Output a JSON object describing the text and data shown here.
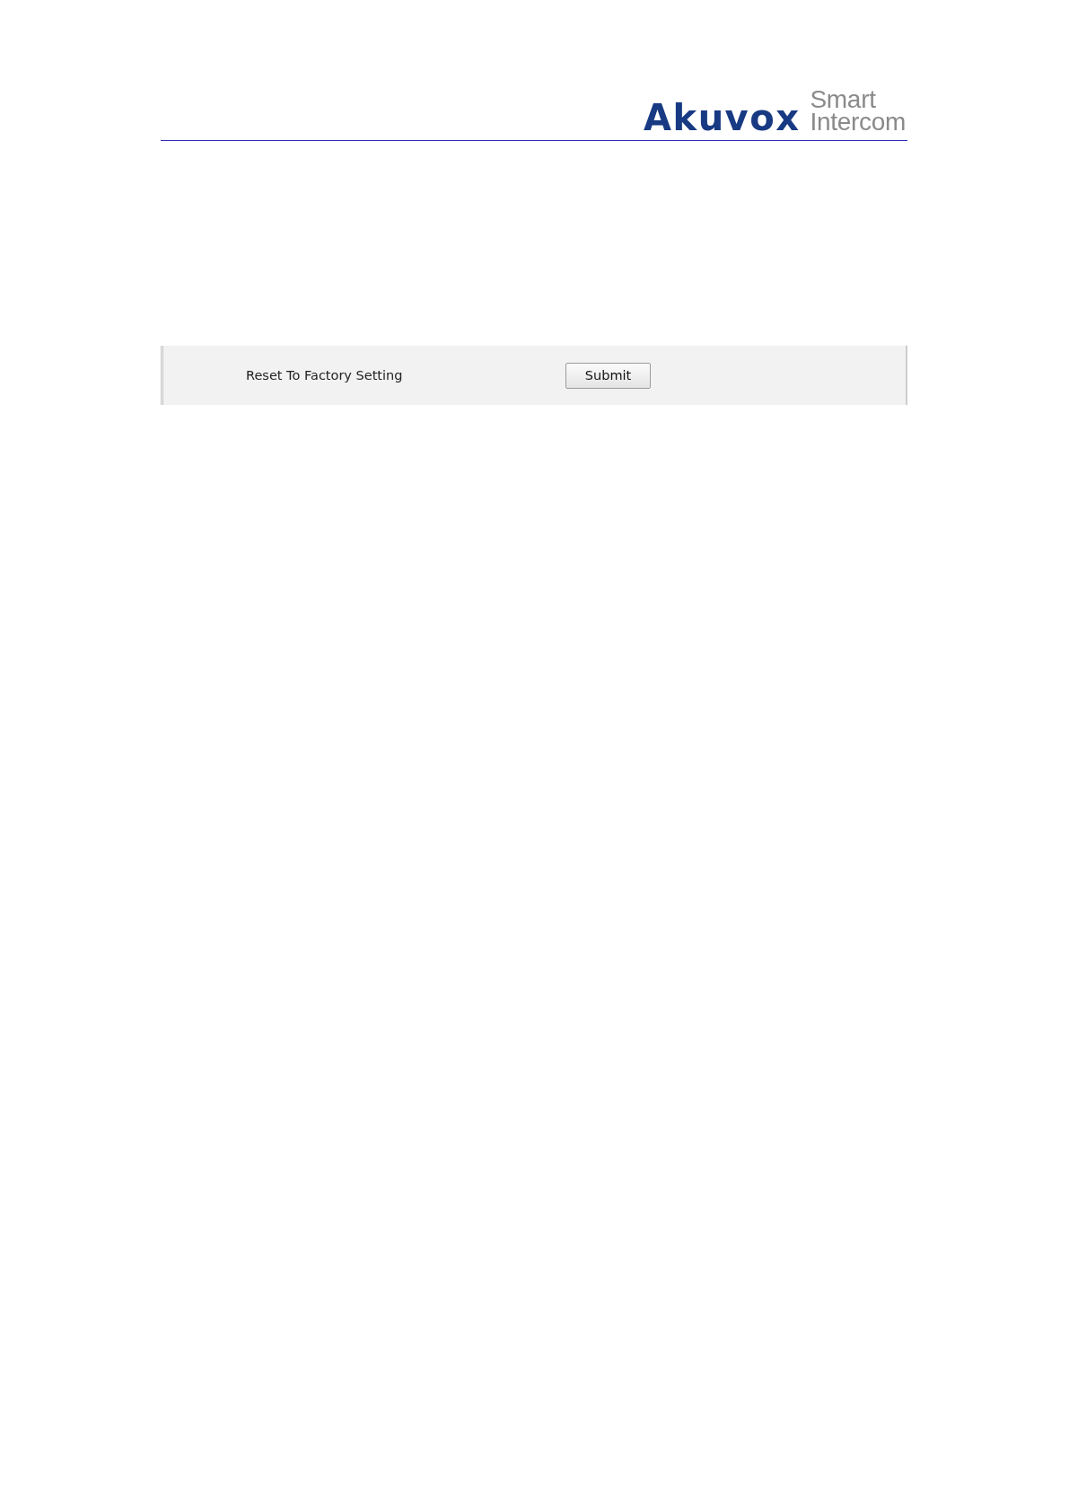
{
  "header": {
    "logo": {
      "brand": "Akuvox",
      "tagline_line_1": "Smart",
      "tagline_line_2": "Intercom"
    }
  },
  "settings_panel": {
    "rows": [
      {
        "label": "Reset To Factory Setting",
        "button": "Submit"
      }
    ]
  }
}
